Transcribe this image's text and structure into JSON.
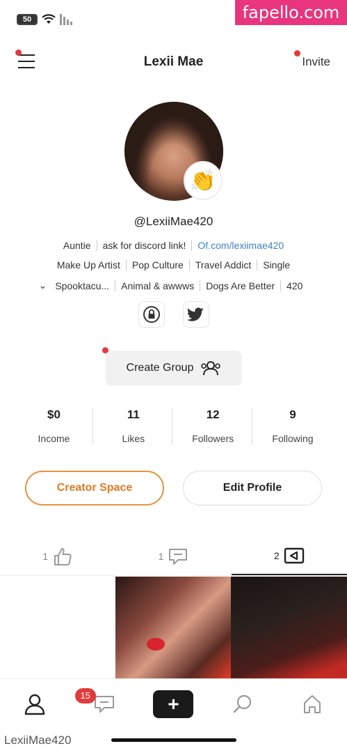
{
  "status_bar": {
    "battery": "50"
  },
  "watermark": "fapello.com",
  "header": {
    "title": "Lexii Mae",
    "invite_label": "Invite"
  },
  "profile": {
    "handle": "@LexiiMae420",
    "tags_row1": [
      "Auntie",
      "ask for discord link!",
      "Of.com/lexiimae420"
    ],
    "tags_row2": [
      "Make Up Artist",
      "Pop Culture",
      "Travel Addict",
      "Single"
    ],
    "tags_row3": [
      "Spooktacu...",
      "Animal & awwws",
      "Dogs Are Better",
      "420"
    ],
    "create_group_label": "Create Group"
  },
  "stats": [
    {
      "value": "$0",
      "label": "Income"
    },
    {
      "value": "11",
      "label": "Likes"
    },
    {
      "value": "12",
      "label": "Followers"
    },
    {
      "value": "9",
      "label": "Following"
    }
  ],
  "buttons": {
    "creator_space": "Creator Space",
    "edit_profile": "Edit Profile"
  },
  "content_tabs": [
    {
      "icon": "thumbs-up-icon",
      "count": "1"
    },
    {
      "icon": "comment-icon",
      "count": "1"
    },
    {
      "icon": "video-icon",
      "count": "2"
    }
  ],
  "bottom_nav": {
    "messages_badge": "15"
  },
  "footer_label": "LexiiMae420",
  "colors": {
    "accent": "#e8923a",
    "link": "#3f7fc6",
    "notification": "#e23b3b",
    "watermark": "#e8357d"
  }
}
